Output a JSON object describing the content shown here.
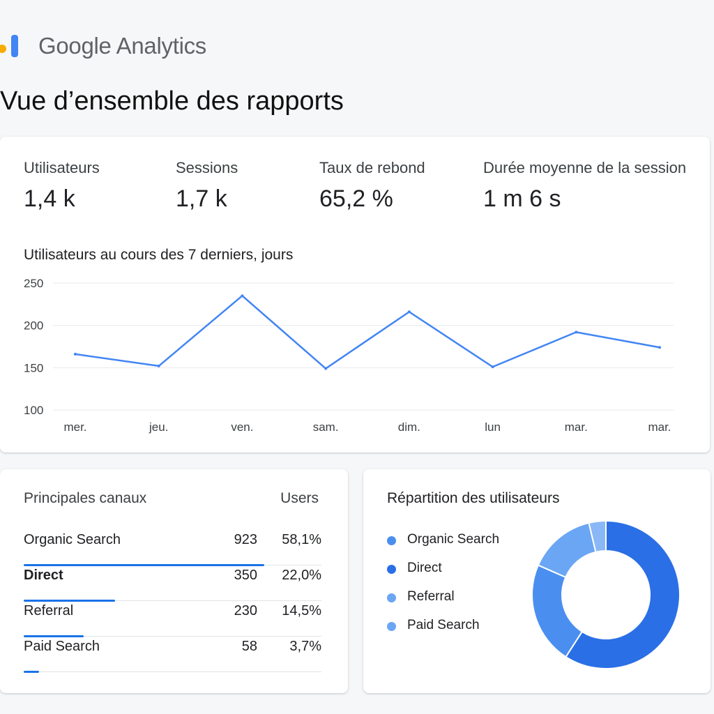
{
  "header": {
    "brand": "Google Analytics",
    "page_title": "Vue d’ensemble des rapports"
  },
  "metrics": [
    {
      "label": "Utilisateurs",
      "value": "1,4 k"
    },
    {
      "label": "Sessions",
      "value": "1,7 k"
    },
    {
      "label": "Taux de rebond",
      "value": "65,2 %"
    },
    {
      "label": "Durée moyenne de la session",
      "value": "1 m 6 s"
    }
  ],
  "chart_data": [
    {
      "type": "line",
      "title": "Utilisateurs au cours des 7 derniers, jours",
      "categories": [
        "mer.",
        "jeu.",
        "ven.",
        "sam.",
        "dim.",
        "lun",
        "mar.",
        "mar."
      ],
      "series": [
        {
          "values": [
            166,
            152,
            235,
            149,
            216,
            151,
            192,
            174
          ]
        }
      ],
      "yticks": [
        250,
        200,
        150,
        100
      ],
      "ylim": [
        100,
        250
      ],
      "grid": true,
      "color": "#4285f4"
    },
    {
      "type": "pie",
      "title": "Répartition des utilisateurs",
      "categories": [
        "Organic Search",
        "Direct",
        "Referral",
        "Paid Search"
      ],
      "values": [
        923,
        350,
        230,
        58
      ],
      "colors": [
        "#2a6fe6",
        "#4a8ff0",
        "#6aa6f4",
        "#8ab8f6"
      ],
      "legend_colors": [
        "#4a8ff0",
        "#2a6fe6",
        "#6aa6f4",
        "#6aa6f4"
      ]
    }
  ],
  "channels": {
    "title": "Principales canaux",
    "users_header": "Users",
    "rows": [
      {
        "name": "Organic Search",
        "users": "923",
        "pct": "58,1%",
        "share": 0.581
      },
      {
        "name": "Direct",
        "users": "350",
        "pct": "22,0%",
        "share": 0.22
      },
      {
        "name": "Referral",
        "users": "230",
        "pct": "14,5%",
        "share": 0.145
      },
      {
        "name": "Paid Search",
        "users": "58",
        "pct": "3,7%",
        "share": 0.037
      }
    ]
  },
  "distribution": {
    "title": "Répartition des utilisateurs",
    "legend": [
      "Organic Search",
      "Direct",
      "Referral",
      "Paid Search"
    ]
  }
}
